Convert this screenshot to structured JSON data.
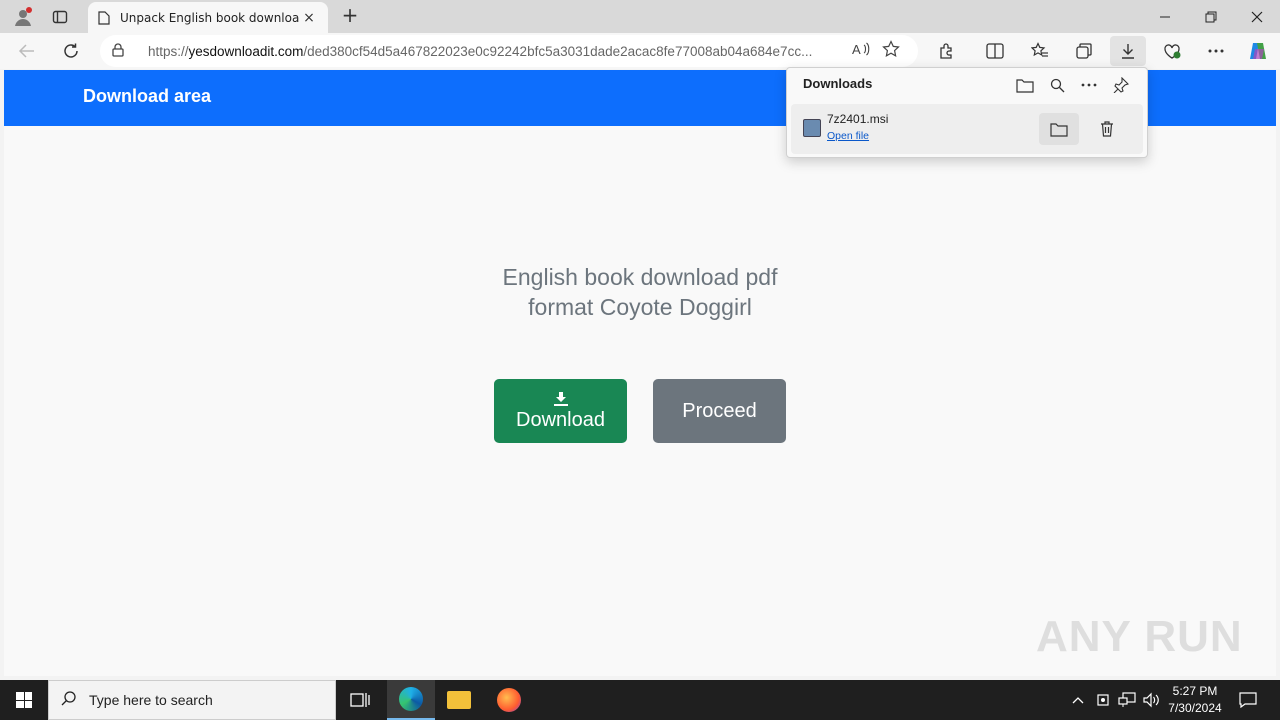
{
  "browser": {
    "tab_title": "Unpack English book download p",
    "tab_close_icon": "×",
    "new_tab_icon": "+",
    "url_host": "yesdownloadit.com",
    "url_scheme": "https://",
    "url_path": "/ded380cf54d5a467822023e0c92242bfc5a3031dade2acac8fe77008ab04a684e7cc..."
  },
  "page": {
    "brand": "Download area",
    "headline_line1": "English book download pdf",
    "headline_line2": "format Coyote Doggirl",
    "download_button": "Download",
    "proceed_button": "Proceed",
    "accent_color": "#0d6efd"
  },
  "downloads_panel": {
    "title": "Downloads",
    "items": [
      {
        "filename": "7z2401.msi",
        "action": "Open file"
      }
    ]
  },
  "taskbar": {
    "search_placeholder": "Type here to search",
    "time": "5:27 PM",
    "date": "7/30/2024"
  },
  "watermark": "ANY RUN"
}
